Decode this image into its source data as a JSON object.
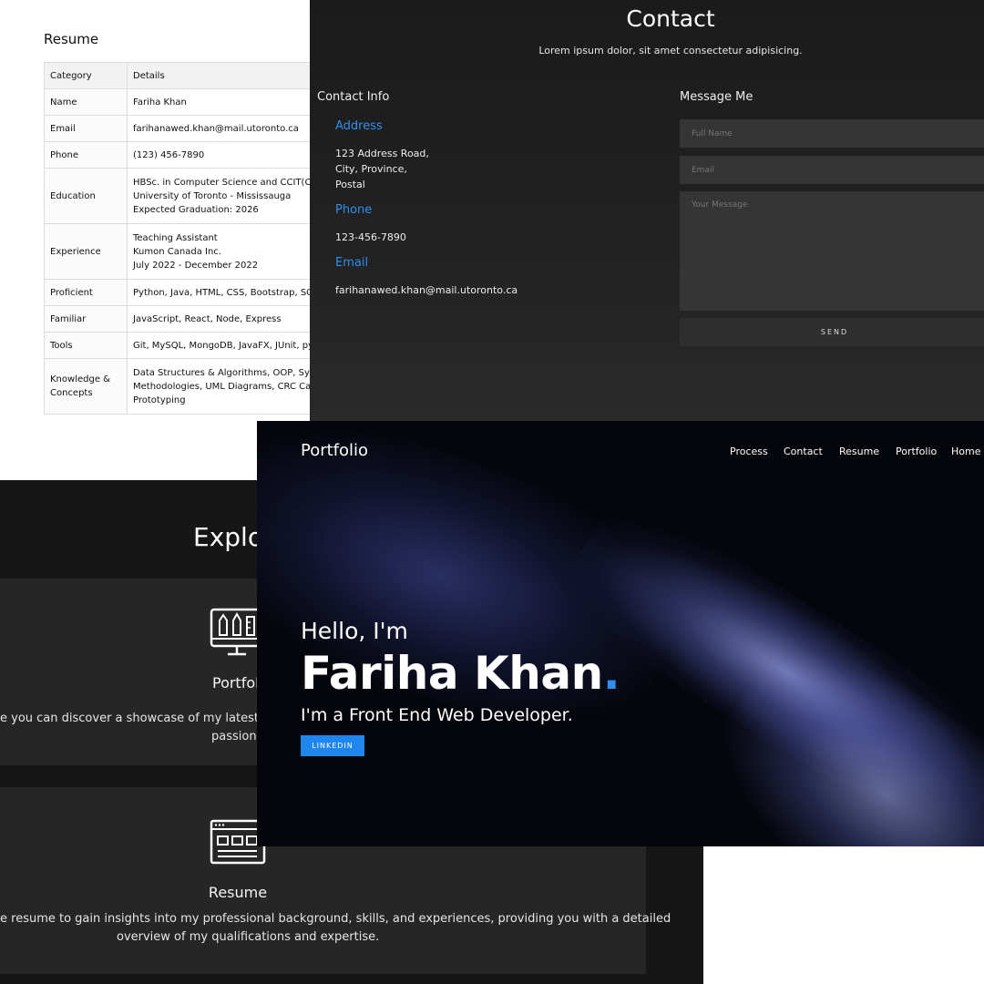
{
  "resume": {
    "title": "Resume",
    "headers": [
      "Category",
      "Details"
    ],
    "rows": [
      {
        "category": "Name",
        "details": [
          "Fariha Khan"
        ]
      },
      {
        "category": "Email",
        "details": [
          "farihanawed.khan@mail.utoronto.ca"
        ]
      },
      {
        "category": "Phone",
        "details": [
          "(123) 456-7890"
        ]
      },
      {
        "category": "Education",
        "details": [
          "HBSc. in Computer Science and CCIT(Co",
          "University of Toronto - Mississauga",
          "Expected Graduation: 2026"
        ]
      },
      {
        "category": "Experience",
        "details": [
          "Teaching Assistant",
          "Kumon Canada Inc.",
          "July 2022 - December 2022"
        ]
      },
      {
        "category": "Proficient",
        "details": [
          "Python, Java, HTML, CSS, Bootstrap, SQL, I"
        ]
      },
      {
        "category": "Familiar",
        "details": [
          "JavaScript, React, Node, Express"
        ]
      },
      {
        "category": "Tools",
        "details": [
          "Git, MySQL, MongoDB, JavaFX, JUnit, pyte"
        ]
      },
      {
        "category": "Knowledge & Concepts",
        "details": [
          "Data Structures & Algorithms, OOP, Syste",
          "Methodologies, UML Diagrams, CRC Card",
          "Prototyping"
        ]
      }
    ]
  },
  "contact": {
    "title": "Contact",
    "subtitle": "Lorem ipsum dolor, sit amet consectetur adipisicing.",
    "info_heading": "Contact Info",
    "address_label": "Address",
    "address_lines": [
      "123 Address Road,",
      "City, Province,",
      "Postal"
    ],
    "phone_label": "Phone",
    "phone_value": "123-456-7890",
    "email_label": "Email",
    "email_value": "farihanawed.khan@mail.utoronto.ca",
    "message_heading": "Message Me",
    "full_name_placeholder": "Full Name",
    "email_placeholder": "Email",
    "message_placeholder": "Your Message",
    "send_label": "SEND"
  },
  "explore": {
    "title": "Explo",
    "cards": [
      {
        "title": "Portfoli",
        "desc_lines": [
          "e you can discover a showcase of my latest pro",
          "passion"
        ],
        "icon": "design-tools-icon"
      },
      {
        "title": "Resume",
        "desc_lines": [
          "e resume to gain insights into my professional background, skills, and experiences, providing you with a detailed",
          "overview of my qualifications and expertise."
        ],
        "icon": "browser-window-icon"
      }
    ]
  },
  "hero": {
    "brand": "Portfolio",
    "nav": [
      "Process",
      "Contact",
      "Resume",
      "Portfolio",
      "Home"
    ],
    "greeting": "Hello, I'm",
    "name": "Fariha Khan",
    "name_dot": ".",
    "role": "I'm a Front End Web Developer.",
    "button": "LINKEDIN"
  },
  "colors": {
    "accent": "#1f86f0",
    "label_blue": "#2f8ff0",
    "dark_bg": "#1b1b1b",
    "card_bg": "#262626",
    "hero_bg": "#05060c"
  }
}
